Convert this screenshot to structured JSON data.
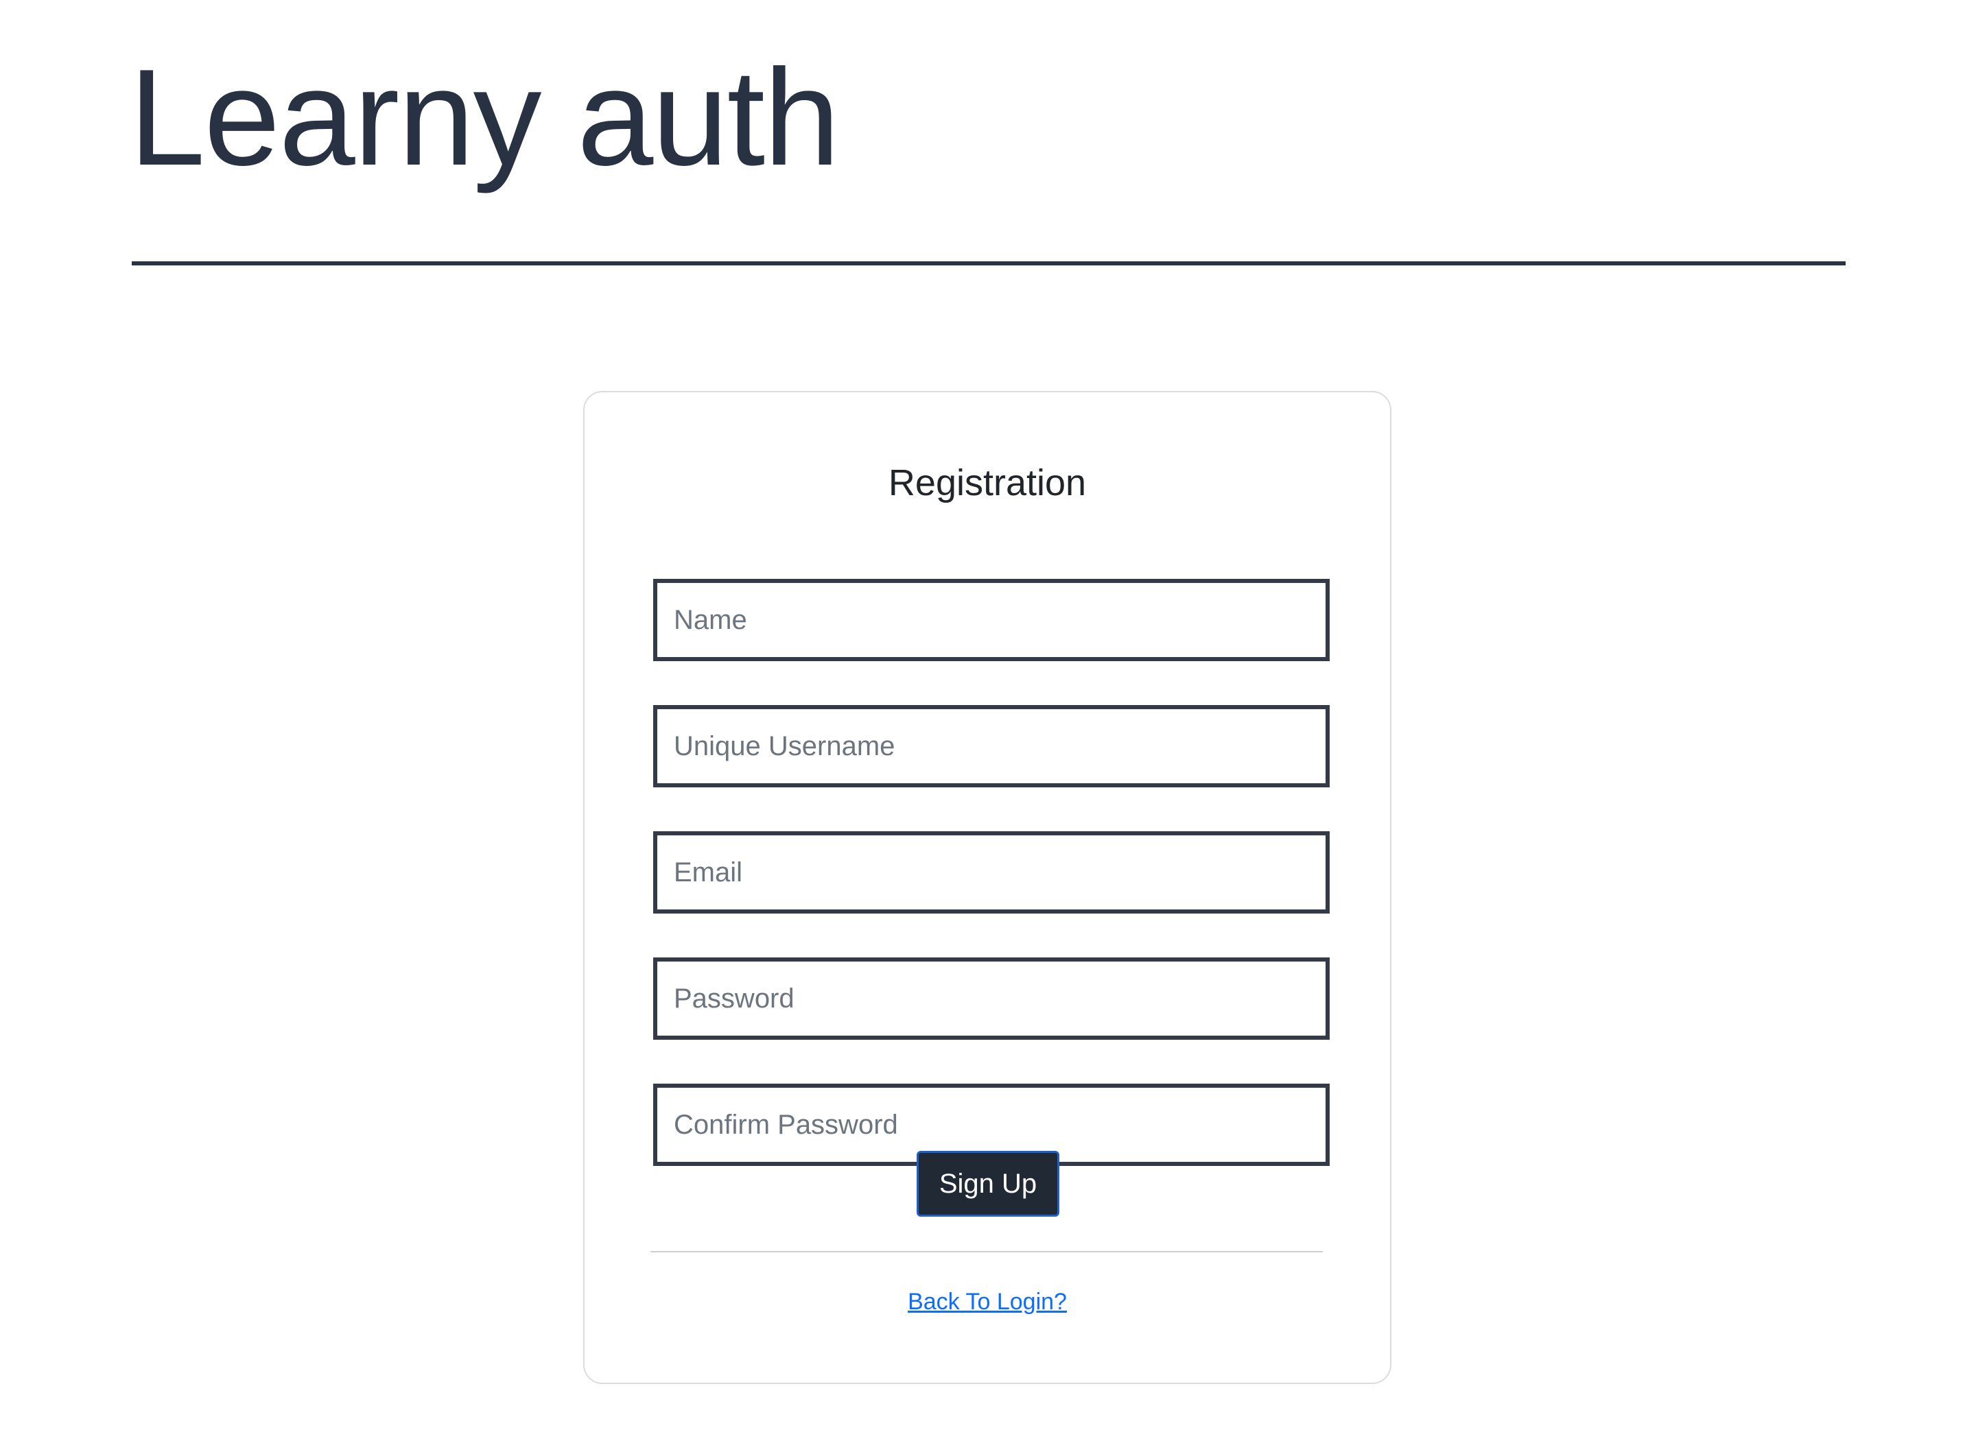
{
  "header": {
    "title": "Learny auth"
  },
  "registration": {
    "title": "Registration",
    "fields": {
      "name": {
        "placeholder": "Name",
        "value": ""
      },
      "username": {
        "placeholder": "Unique Username",
        "value": ""
      },
      "email": {
        "placeholder": "Email",
        "value": ""
      },
      "password": {
        "placeholder": "Password",
        "value": ""
      },
      "confirm_password": {
        "placeholder": "Confirm Password",
        "value": ""
      }
    },
    "submit_label": "Sign Up",
    "login_link_label": "Back To Login?"
  },
  "colors": {
    "primary_dark": "#283242",
    "field_border": "#343a46",
    "button_bg": "#212935",
    "button_border": "#1e5fc9",
    "link": "#0d6efd",
    "card_border": "#dcdcdc"
  }
}
